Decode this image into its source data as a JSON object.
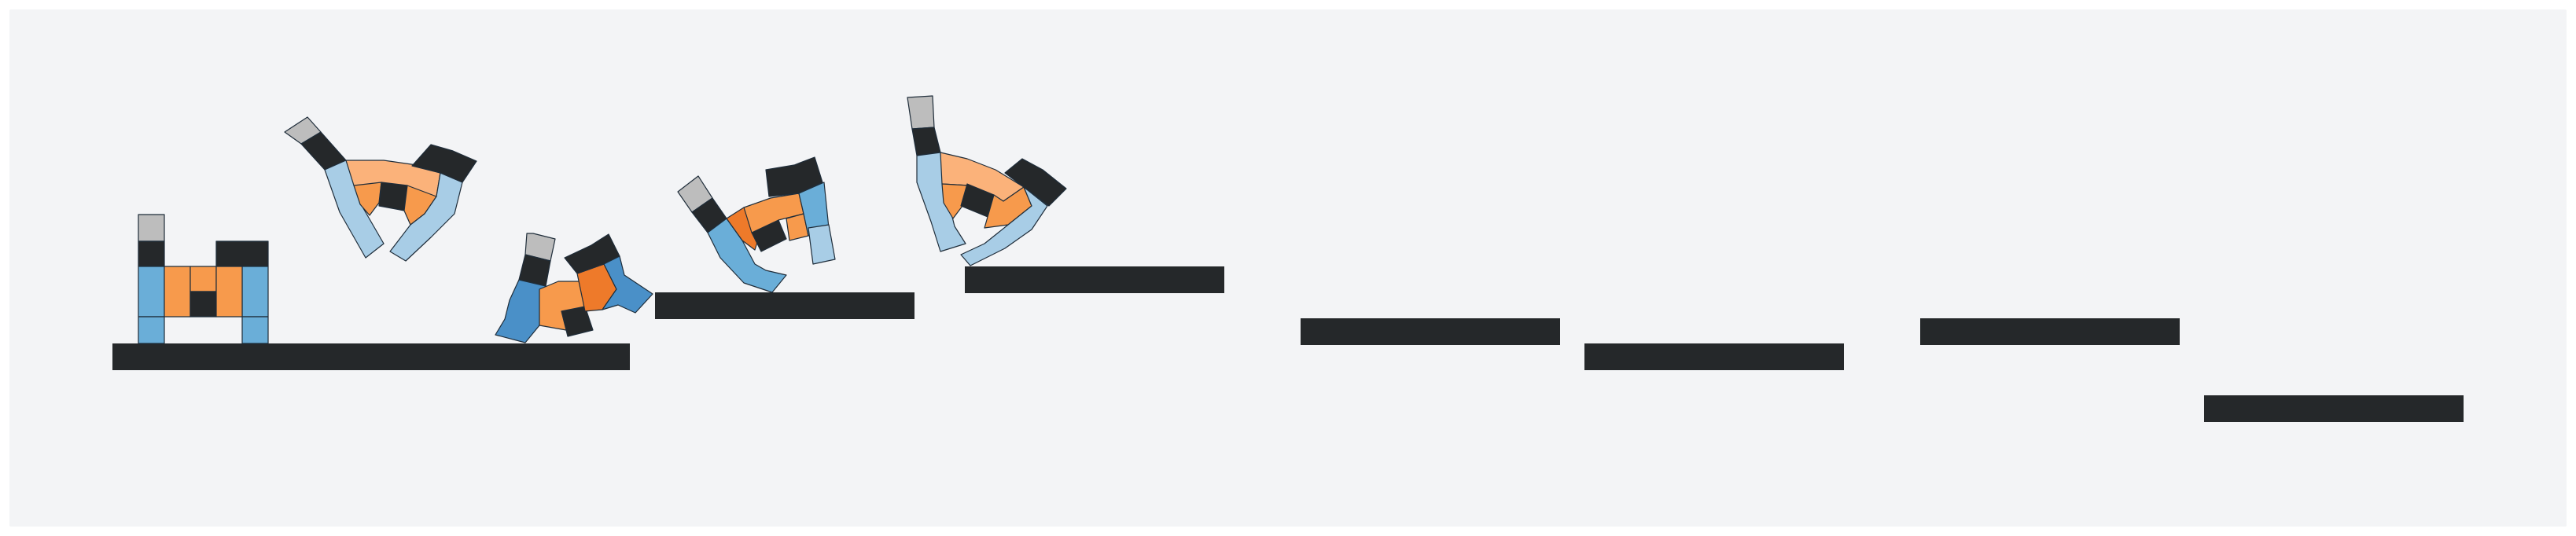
{
  "scene": {
    "background_color": "#f3f4f6",
    "frame_color": "#ffffff",
    "platform_color": "#25282a",
    "outline_color": "#1f2d3a"
  },
  "palette": {
    "blue_dark": "#4a90c8",
    "blue_mid": "#6aaed8",
    "blue_light": "#a8cde6",
    "orange_dark": "#ee7a2a",
    "orange_mid": "#f79a4c",
    "orange_light": "#fbb27a",
    "gray_tip": "#bdbdbd",
    "black_block": "#25282a",
    "hole": "#ffffff"
  },
  "platforms": {
    "count": 8
  },
  "robot_poses": {
    "count": 5,
    "description_icons": [
      "standing-robot",
      "arched-robot",
      "crouched-robot",
      "tilted-robot",
      "leaping-robot"
    ]
  }
}
